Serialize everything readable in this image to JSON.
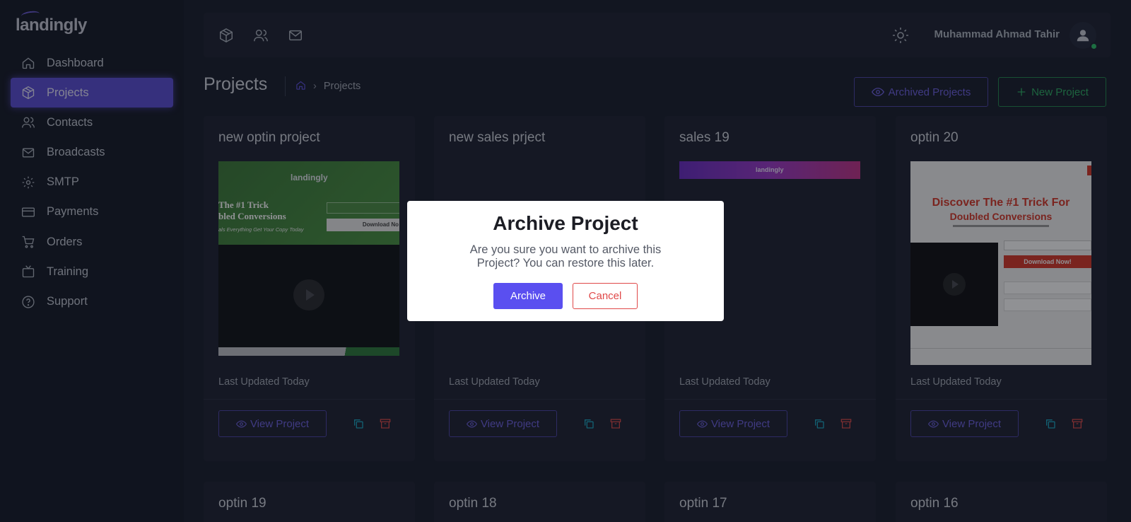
{
  "app": {
    "logo_text": "landingly"
  },
  "sidebar": {
    "items": [
      {
        "label": "Dashboard",
        "icon": "home-icon"
      },
      {
        "label": "Projects",
        "icon": "box-icon",
        "active": true
      },
      {
        "label": "Contacts",
        "icon": "users-icon"
      },
      {
        "label": "Broadcasts",
        "icon": "mail-icon"
      },
      {
        "label": "SMTP",
        "icon": "gear-icon"
      },
      {
        "label": "Payments",
        "icon": "card-icon"
      },
      {
        "label": "Orders",
        "icon": "cart-icon"
      },
      {
        "label": "Training",
        "icon": "tv-icon"
      },
      {
        "label": "Support",
        "icon": "help-icon"
      }
    ]
  },
  "topbar": {
    "user_name": "Muhammad Ahmad Tahir"
  },
  "page": {
    "title": "Projects",
    "breadcrumb": "Projects",
    "archived_button": "Archived Projects",
    "new_button": "New Project"
  },
  "cards": [
    {
      "title": "new optin project",
      "updated": "Last Updated Today",
      "view_label": "View Project",
      "thumb": {
        "logo": "landingly",
        "headline1": "The #1 Trick",
        "headline2": "bled Conversions",
        "sub": "als Everything Get Your Copy Today",
        "cta": "Download No"
      }
    },
    {
      "title": "new sales prject",
      "updated": "Last Updated Today",
      "view_label": "View Project"
    },
    {
      "title": "sales 19",
      "updated": "Last Updated Today",
      "view_label": "View Project",
      "thumb": {
        "logo": "landingly"
      }
    },
    {
      "title": "optin 20",
      "updated": "Last Updated Today",
      "view_label": "View Project",
      "thumb": {
        "headline1": "Discover The #1 Trick For",
        "headline2": "Doubled Conversions",
        "cta": "Download Now!"
      }
    },
    {
      "title": "optin 19"
    },
    {
      "title": "optin 18"
    },
    {
      "title": "optin 17"
    },
    {
      "title": "optin 16"
    }
  ],
  "modal": {
    "title": "Archive Project",
    "text": "Are you sure you want to archive this Project? You can restore this later.",
    "confirm": "Archive",
    "cancel": "Cancel"
  },
  "colors": {
    "accent": "#5b4fd6",
    "success": "#2fae64",
    "danger": "#e04848",
    "bg": "#1a1f2e"
  }
}
